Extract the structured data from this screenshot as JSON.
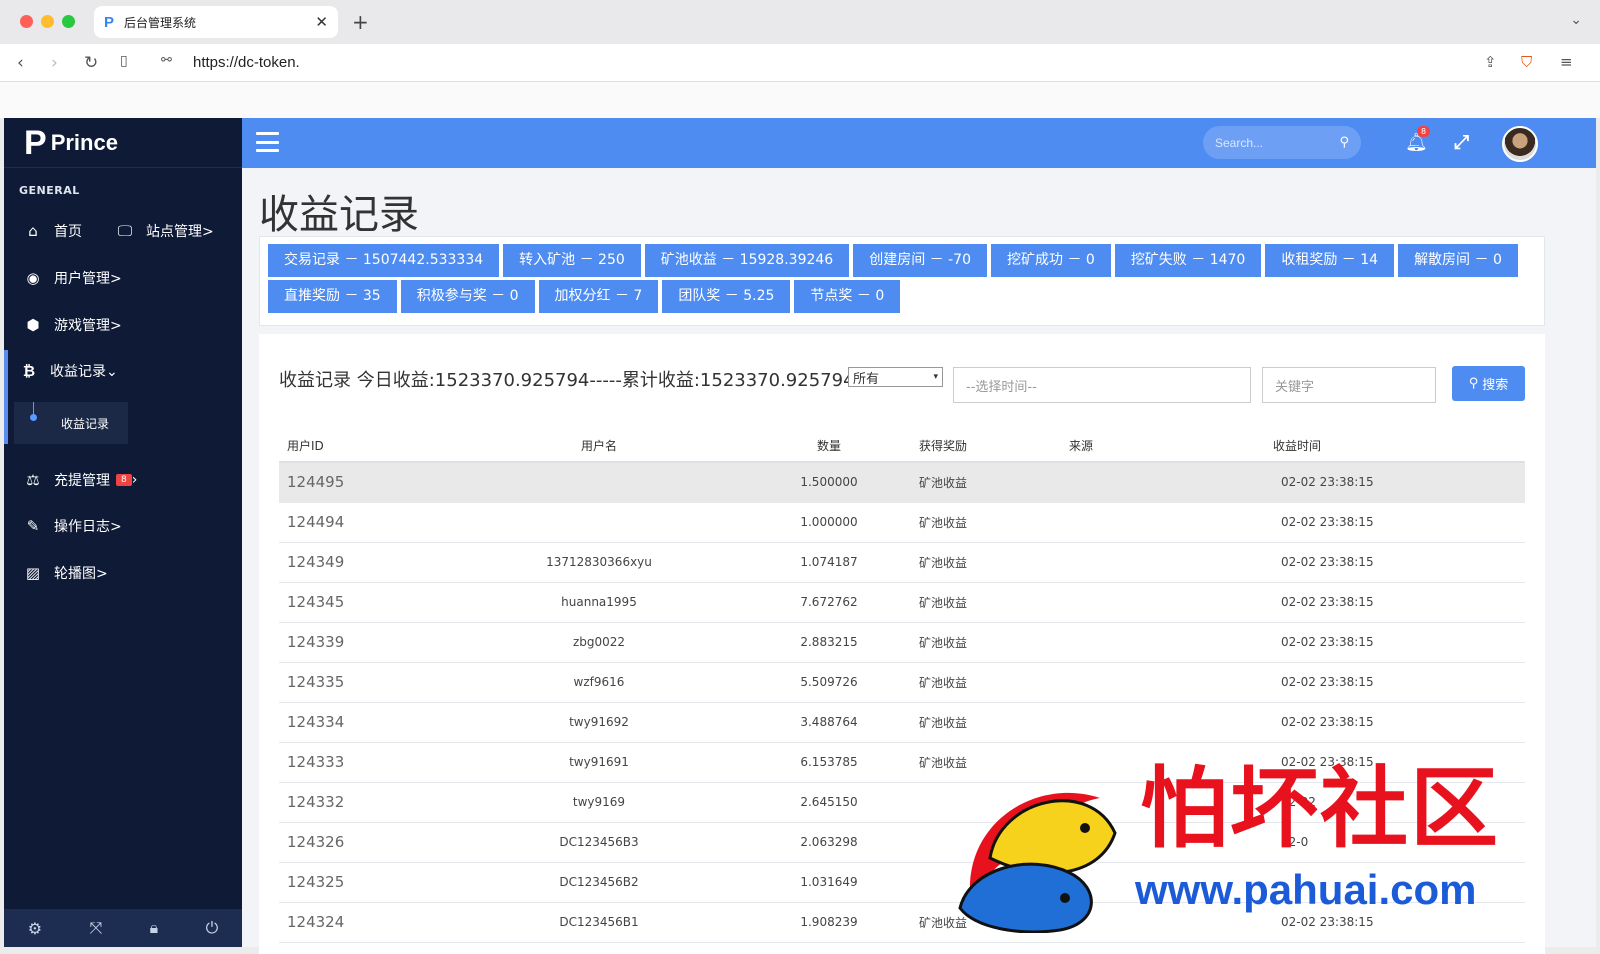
{
  "browser": {
    "tab_title": "后台管理系统",
    "tab_icon": "P",
    "url": "https://dc-token."
  },
  "sidebar": {
    "brand": "Prince",
    "brand_logo": "P",
    "section": "GENERAL",
    "items": [
      {
        "icon": "home-icon",
        "label": "首页"
      },
      {
        "icon": "monitor-icon",
        "label": "站点管理>"
      },
      {
        "icon": "user-icon",
        "label": "用户管理>"
      },
      {
        "icon": "cube-icon",
        "label": "游戏管理>"
      },
      {
        "icon": "bitcoin-icon",
        "label": "收益记录⌄"
      },
      {
        "icon": "scale-icon",
        "label": "充提管理",
        "badge": "8"
      },
      {
        "icon": "edit-icon",
        "label": "操作日志>"
      },
      {
        "icon": "image-icon",
        "label": "轮播图>"
      }
    ],
    "subitem": "收益记录"
  },
  "topbar": {
    "search_placeholder": "Search...",
    "notif_count": "8"
  },
  "page": {
    "title": "收益记录",
    "stats": [
      "交易记录 － 1507442.533334",
      "转入矿池 － 250",
      "矿池收益 － 15928.39246",
      "创建房间 － -70",
      "挖矿成功 － 0",
      "挖矿失败 － 1470",
      "收租奖励 － 14",
      "解散房间 － 0",
      "直推奖励 － 35",
      "积极参与奖 － 0",
      "加权分红 － 7",
      "团队奖 － 5.25",
      "节点奖 － 0"
    ],
    "records_title": "收益记录 今日收益:1523370.925794-----累计收益:1523370.925794",
    "filter_select": "所有",
    "time_placeholder": "--选择时间--",
    "keyword_placeholder": "关键字",
    "search_button": "搜索"
  },
  "table": {
    "headers": [
      "用户ID",
      "用户名",
      "数量",
      "获得奖励",
      "来源",
      "收益时间"
    ],
    "rows": [
      [
        "124495",
        "",
        "1.500000",
        "矿池收益",
        "",
        "02-02 23:38:15"
      ],
      [
        "124494",
        "",
        "1.000000",
        "矿池收益",
        "",
        "02-02 23:38:15"
      ],
      [
        "124349",
        "13712830366xyu",
        "1.074187",
        "矿池收益",
        "",
        "02-02 23:38:15"
      ],
      [
        "124345",
        "huanna1995",
        "7.672762",
        "矿池收益",
        "",
        "02-02 23:38:15"
      ],
      [
        "124339",
        "zbg0022",
        "2.883215",
        "矿池收益",
        "",
        "02-02 23:38:15"
      ],
      [
        "124335",
        "wzf9616",
        "5.509726",
        "矿池收益",
        "",
        "02-02 23:38:15"
      ],
      [
        "124334",
        "twy91692",
        "3.488764",
        "矿池收益",
        "",
        "02-02 23:38:15"
      ],
      [
        "124333",
        "twy91691",
        "6.153785",
        "矿池收益",
        "",
        "02-02 23:38:15"
      ],
      [
        "124332",
        "twy9169",
        "2.645150",
        "",
        "",
        "02-02"
      ],
      [
        "124326",
        "DC123456B3",
        "2.063298",
        "",
        "",
        "02-0"
      ],
      [
        "124325",
        "DC123456B2",
        "1.031649",
        "",
        "",
        ""
      ],
      [
        "124324",
        "DC123456B1",
        "1.908239",
        "矿池收益",
        "",
        "02-02 23:38:15"
      ]
    ]
  },
  "watermark": {
    "text": "怕坏社区",
    "url": "www.pahuai.com"
  }
}
